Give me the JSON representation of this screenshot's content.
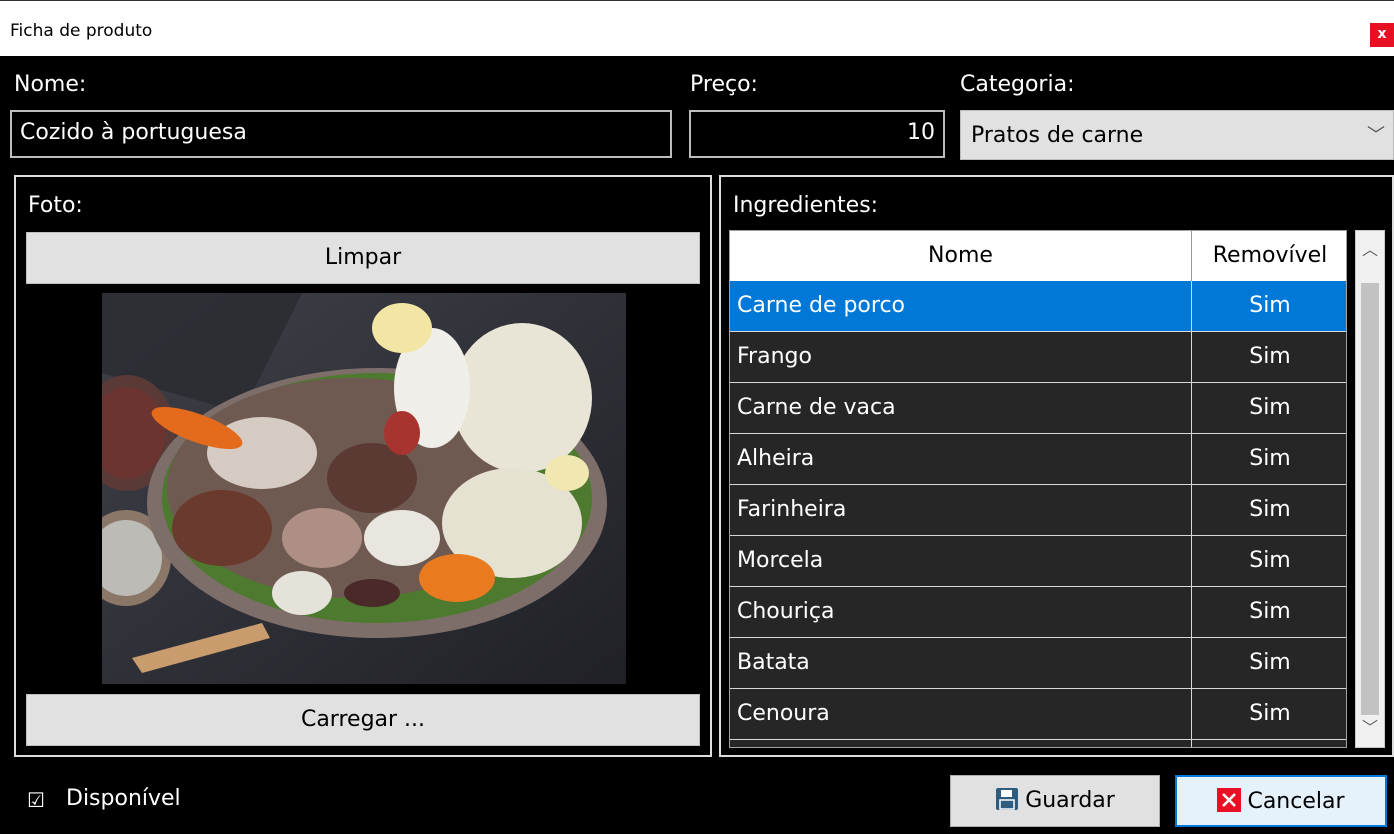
{
  "window": {
    "title": "Ficha de produto",
    "close_label": "x"
  },
  "form": {
    "nome_label": "Nome:",
    "nome_value": "Cozido à portuguesa",
    "preco_label": "Preço:",
    "preco_value": "10",
    "categoria_label": "Categoria:",
    "categoria_value": "Pratos de carne"
  },
  "foto": {
    "label": "Foto:",
    "limpar_label": "Limpar",
    "carregar_label": "Carregar ..."
  },
  "ingredientes": {
    "label": "Ingredientes:",
    "columns": [
      "Nome",
      "Removível"
    ],
    "rows": [
      {
        "nome": "Carne de porco",
        "removivel": "Sim"
      },
      {
        "nome": "Frango",
        "removivel": "Sim"
      },
      {
        "nome": "Carne de vaca",
        "removivel": "Sim"
      },
      {
        "nome": "Alheira",
        "removivel": "Sim"
      },
      {
        "nome": "Farinheira",
        "removivel": "Sim"
      },
      {
        "nome": "Morcela",
        "removivel": "Sim"
      },
      {
        "nome": "Chouriça",
        "removivel": "Sim"
      },
      {
        "nome": "Batata",
        "removivel": "Sim"
      },
      {
        "nome": "Cenoura",
        "removivel": "Sim"
      }
    ],
    "selected_index": 0
  },
  "footer": {
    "disponivel_label": "Disponível",
    "disponivel_checked": true,
    "guardar_label": "Guardar",
    "cancelar_label": "Cancelar"
  },
  "colors": {
    "selection": "#0078d7",
    "close": "#e81123",
    "accent_border": "#0078d7"
  }
}
